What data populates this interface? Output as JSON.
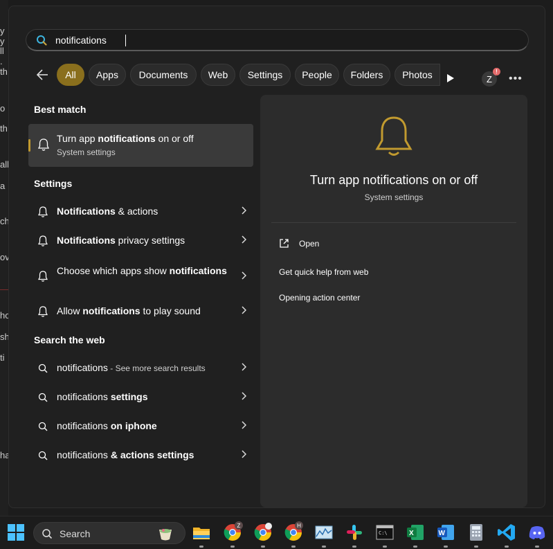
{
  "background_fragments": [
    "y y",
    "ll .",
    "th",
    "o",
    "th",
    "all",
    "a",
    "ch",
    "ov",
    "ho",
    "sh",
    "ti",
    "ha"
  ],
  "search": {
    "query": "notifications"
  },
  "filters": [
    {
      "label": "All",
      "active": true
    },
    {
      "label": "Apps"
    },
    {
      "label": "Documents"
    },
    {
      "label": "Web"
    },
    {
      "label": "Settings"
    },
    {
      "label": "People"
    },
    {
      "label": "Folders"
    },
    {
      "label": "Photos"
    }
  ],
  "account": {
    "initial": "Z",
    "badge": "!"
  },
  "best_match": {
    "heading": "Best match",
    "title_pre": "Turn app ",
    "title_bold": "notifications",
    "title_post": " on or off",
    "subtitle": "System settings"
  },
  "settings_section": {
    "heading": "Settings",
    "items": [
      {
        "pre": "",
        "bold": "Notifications",
        "post": " & actions"
      },
      {
        "pre": "",
        "bold": "Notifications",
        "post": " privacy settings"
      },
      {
        "pre": "Choose which apps show ",
        "bold": "notifications",
        "post": ""
      },
      {
        "pre": "Allow ",
        "bold": "notifications",
        "post": " to play sound"
      }
    ]
  },
  "web_section": {
    "heading": "Search the web",
    "items": [
      {
        "pre": "notifications",
        "bold": "",
        "post": "",
        "small": " - See more search results"
      },
      {
        "pre": "notifications ",
        "bold": "settings",
        "post": ""
      },
      {
        "pre": "notifications ",
        "bold": "on iphone",
        "post": ""
      },
      {
        "pre": "notifications ",
        "bold": "& actions settings",
        "post": ""
      }
    ]
  },
  "preview": {
    "title": "Turn app notifications on or off",
    "subtitle": "System settings",
    "open_label": "Open",
    "actions": [
      "Get quick help from web",
      "Opening action center"
    ]
  },
  "taskbar": {
    "search_label": "Search",
    "apps": [
      {
        "name": "file-explorer-icon"
      },
      {
        "name": "chrome-z-icon",
        "badge": "Z"
      },
      {
        "name": "chrome-icon"
      },
      {
        "name": "chrome-h-icon",
        "badge": "H"
      },
      {
        "name": "resource-monitor-icon"
      },
      {
        "name": "slack-icon"
      },
      {
        "name": "terminal-icon"
      },
      {
        "name": "excel-icon"
      },
      {
        "name": "word-icon"
      },
      {
        "name": "calculator-icon"
      },
      {
        "name": "vscode-icon"
      },
      {
        "name": "discord-icon"
      }
    ]
  },
  "colors": {
    "accent": "#8a6f1d",
    "bell": "#c19a2f"
  }
}
